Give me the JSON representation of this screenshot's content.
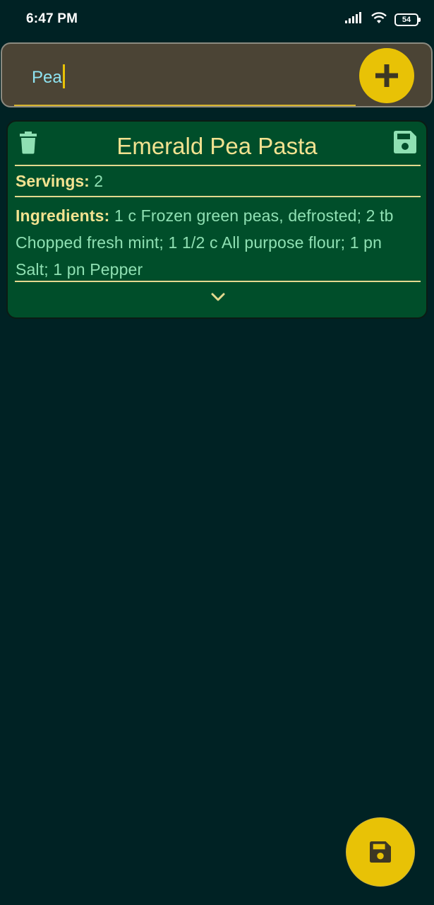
{
  "status_bar": {
    "time": "6:47 PM",
    "battery": "54",
    "icons": [
      "signal-icon",
      "wifi-icon",
      "battery-icon"
    ]
  },
  "search": {
    "value": "Pea",
    "add_icon": "plus-icon"
  },
  "recipe": {
    "title": "Emerald Pea Pasta",
    "servings_label": "Servings:",
    "servings_value": "2",
    "ingredients_label": "Ingredients:",
    "ingredients_value": "1 c Frozen green peas, defrosted; 2 tb Chopped fresh mint; 1 1/2 c All purpose flour; 1 pn Salt; 1 pn Pepper",
    "delete_icon": "trash-icon",
    "save_icon": "floppy-disk-icon",
    "expand_icon": "chevron-down-icon"
  },
  "fab": {
    "icon": "floppy-disk-icon"
  },
  "colors": {
    "background": "#002224",
    "search_bg": "#4b4435",
    "accent_yellow": "#e8c206",
    "card_bg": "#004e2a",
    "title_color": "#f2e290",
    "value_color": "#8fe0b3",
    "search_text": "#8fe4f2",
    "icon_green": "#8fe0b3"
  }
}
